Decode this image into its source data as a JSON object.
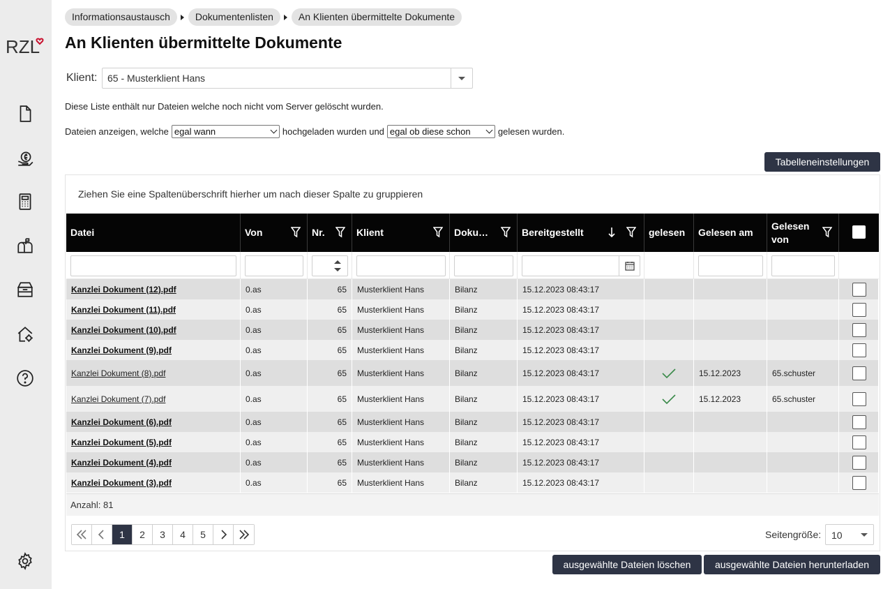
{
  "app": {
    "logo_text": "RZL"
  },
  "sidebar": {
    "items": [
      {
        "icon": "document-icon"
      },
      {
        "icon": "euro-coins-icon"
      },
      {
        "icon": "calculator-icon"
      },
      {
        "icon": "mailbox-icon"
      },
      {
        "icon": "archive-box-icon"
      },
      {
        "icon": "house-settings-icon"
      },
      {
        "icon": "help-icon"
      },
      {
        "icon": "gear-icon"
      }
    ]
  },
  "breadcrumb": [
    "Informationsaustausch",
    "Dokumentenlisten",
    "An Klienten übermittelte Dokumente"
  ],
  "page_title": "An Klienten übermittelte Dokumente",
  "client": {
    "label": "Klient:",
    "value": "65 - Musterklient Hans"
  },
  "info_text": "Diese Liste enthält nur Dateien welche noch nicht vom Server gelöscht wurden.",
  "filter_sentence": {
    "part1": "Dateien anzeigen, welche",
    "select1": "egal wann",
    "part2": "hochgeladen wurden und",
    "select2": "egal ob diese schon",
    "part3": "gelesen wurden."
  },
  "table_settings_button": "Tabelleneinstellungen",
  "group_hint": "Ziehen Sie eine Spaltenüberschrift hierher um nach dieser Spalte zu gruppieren",
  "columns": {
    "datei": "Datei",
    "von": "Von",
    "nr": "Nr.",
    "klient": "Klient",
    "doku": "Doku…",
    "bereitgestellt": "Bereitgestellt",
    "gelesen": "gelesen",
    "gelesen_am": "Gelesen am",
    "gelesen_von": "Gelesen von"
  },
  "rows": [
    {
      "datei": "Kanzlei Dokument (12).pdf",
      "bold": true,
      "von": "0.as",
      "nr": "65",
      "klient": "Musterklient Hans",
      "doku": "Bilanz",
      "bereitgestellt": "15.12.2023 08:43:17",
      "gelesen": false,
      "gelesen_am": "",
      "gelesen_von": ""
    },
    {
      "datei": "Kanzlei Dokument (11).pdf",
      "bold": true,
      "von": "0.as",
      "nr": "65",
      "klient": "Musterklient Hans",
      "doku": "Bilanz",
      "bereitgestellt": "15.12.2023 08:43:17",
      "gelesen": false,
      "gelesen_am": "",
      "gelesen_von": ""
    },
    {
      "datei": "Kanzlei Dokument (10).pdf",
      "bold": true,
      "von": "0.as",
      "nr": "65",
      "klient": "Musterklient Hans",
      "doku": "Bilanz",
      "bereitgestellt": "15.12.2023 08:43:17",
      "gelesen": false,
      "gelesen_am": "",
      "gelesen_von": ""
    },
    {
      "datei": "Kanzlei Dokument (9).pdf",
      "bold": true,
      "von": "0.as",
      "nr": "65",
      "klient": "Musterklient Hans",
      "doku": "Bilanz",
      "bereitgestellt": "15.12.2023 08:43:17",
      "gelesen": false,
      "gelesen_am": "",
      "gelesen_von": ""
    },
    {
      "datei": "Kanzlei Dokument (8).pdf",
      "bold": false,
      "von": "0.as",
      "nr": "65",
      "klient": "Musterklient Hans",
      "doku": "Bilanz",
      "bereitgestellt": "15.12.2023 08:43:17",
      "gelesen": true,
      "gelesen_am": "15.12.2023",
      "gelesen_von": "65.schuster"
    },
    {
      "datei": "Kanzlei Dokument (7).pdf",
      "bold": false,
      "von": "0.as",
      "nr": "65",
      "klient": "Musterklient Hans",
      "doku": "Bilanz",
      "bereitgestellt": "15.12.2023 08:43:17",
      "gelesen": true,
      "gelesen_am": "15.12.2023",
      "gelesen_von": "65.schuster"
    },
    {
      "datei": "Kanzlei Dokument (6).pdf",
      "bold": true,
      "von": "0.as",
      "nr": "65",
      "klient": "Musterklient Hans",
      "doku": "Bilanz",
      "bereitgestellt": "15.12.2023 08:43:17",
      "gelesen": false,
      "gelesen_am": "",
      "gelesen_von": ""
    },
    {
      "datei": "Kanzlei Dokument (5).pdf",
      "bold": true,
      "von": "0.as",
      "nr": "65",
      "klient": "Musterklient Hans",
      "doku": "Bilanz",
      "bereitgestellt": "15.12.2023 08:43:17",
      "gelesen": false,
      "gelesen_am": "",
      "gelesen_von": ""
    },
    {
      "datei": "Kanzlei Dokument (4).pdf",
      "bold": true,
      "von": "0.as",
      "nr": "65",
      "klient": "Musterklient Hans",
      "doku": "Bilanz",
      "bereitgestellt": "15.12.2023 08:43:17",
      "gelesen": false,
      "gelesen_am": "",
      "gelesen_von": ""
    },
    {
      "datei": "Kanzlei Dokument (3).pdf",
      "bold": true,
      "von": "0.as",
      "nr": "65",
      "klient": "Musterklient Hans",
      "doku": "Bilanz",
      "bereitgestellt": "15.12.2023 08:43:17",
      "gelesen": false,
      "gelesen_am": "",
      "gelesen_von": ""
    }
  ],
  "count_text": "Anzahl: 81",
  "pager": {
    "pages": [
      "1",
      "2",
      "3",
      "4",
      "5"
    ],
    "current": "1"
  },
  "page_size": {
    "label": "Seitengröße:",
    "value": "10"
  },
  "actions": {
    "delete": "ausgewählte Dateien löschen",
    "download": "ausgewählte Dateien herunterladen"
  },
  "colors": {
    "header_bg": "#050505",
    "button_bg": "#2e3445",
    "sidebar_bg": "#ececec",
    "logo_heart": "#c8102e",
    "check_green": "#3a8a4a"
  }
}
